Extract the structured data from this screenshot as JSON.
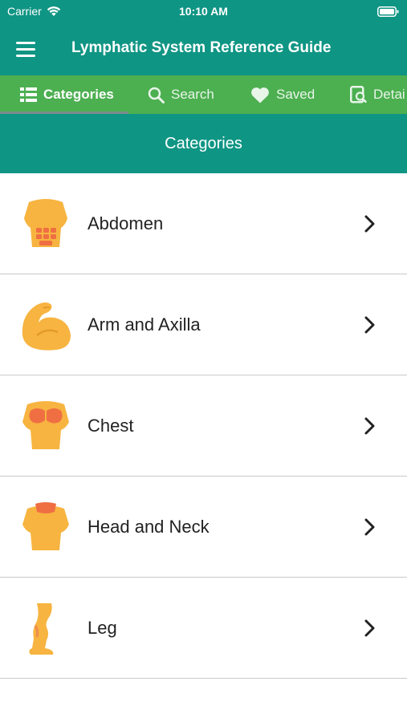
{
  "status": {
    "carrier": "Carrier",
    "time": "10:10 AM"
  },
  "app": {
    "title": "Lymphatic System Reference Guide"
  },
  "tabs": [
    {
      "label": "Categories",
      "icon": "list-icon",
      "active": true
    },
    {
      "label": "Search",
      "icon": "search-icon",
      "active": false
    },
    {
      "label": "Saved",
      "icon": "heart-icon",
      "active": false
    },
    {
      "label": "Detai",
      "icon": "details-icon",
      "active": false
    }
  ],
  "section": {
    "title": "Categories"
  },
  "categories": [
    {
      "label": "Abdomen",
      "icon": "abdomen-icon"
    },
    {
      "label": "Arm and Axilla",
      "icon": "arm-icon"
    },
    {
      "label": "Chest",
      "icon": "chest-icon"
    },
    {
      "label": "Head and Neck",
      "icon": "head-neck-icon"
    },
    {
      "label": "Leg",
      "icon": "leg-icon"
    }
  ],
  "colors": {
    "primary": "#0f9584",
    "tabbar": "#4caf50",
    "icon_skin": "#f7b440",
    "icon_highlight": "#ef6f43"
  }
}
